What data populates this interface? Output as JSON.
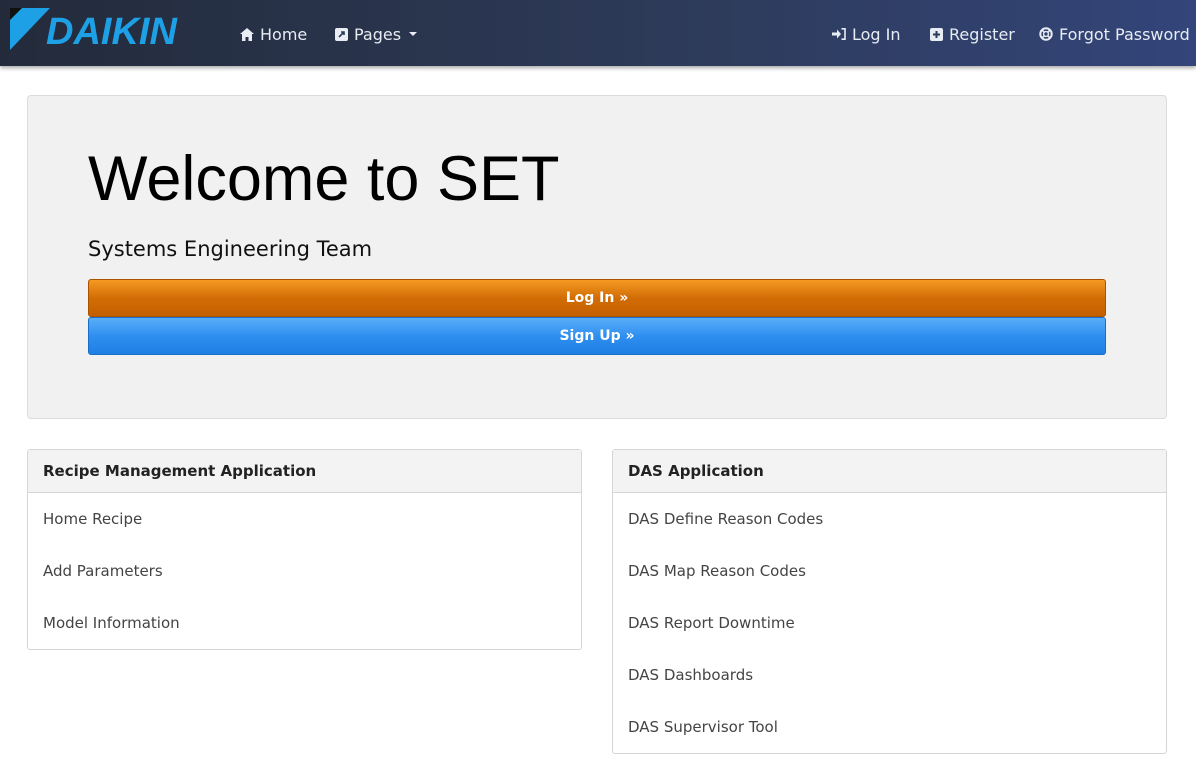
{
  "navbar": {
    "brand": "DAIKIN",
    "left_items": [
      {
        "label": "Home",
        "icon": "home-icon"
      },
      {
        "label": "Pages",
        "icon": "external-link-icon"
      }
    ],
    "right_items": [
      {
        "label": "Log In",
        "icon": "sign-in-icon"
      },
      {
        "label": "Register",
        "icon": "plus-square-icon"
      },
      {
        "label": "Forgot Password",
        "icon": "life-ring-icon"
      }
    ]
  },
  "hero": {
    "title": "Welcome to SET",
    "subtitle": "Systems Engineering Team",
    "login_button": "Log In »",
    "signup_button": "Sign Up »"
  },
  "panels": {
    "recipe": {
      "title": "Recipe Management Application",
      "items": [
        "Home Recipe",
        "Add Parameters",
        "Model Information"
      ]
    },
    "das": {
      "title": "DAS Application",
      "items": [
        "DAS Define Reason Codes",
        "DAS Map Reason Codes",
        "DAS Report Downtime",
        "DAS Dashboards",
        "DAS Supervisor Tool"
      ]
    }
  },
  "colors": {
    "brand_blue": "#1ea0e6",
    "login_orange": "#d26d05",
    "signup_blue": "#2f8ff0",
    "navbar_dark": "#232b3b"
  }
}
